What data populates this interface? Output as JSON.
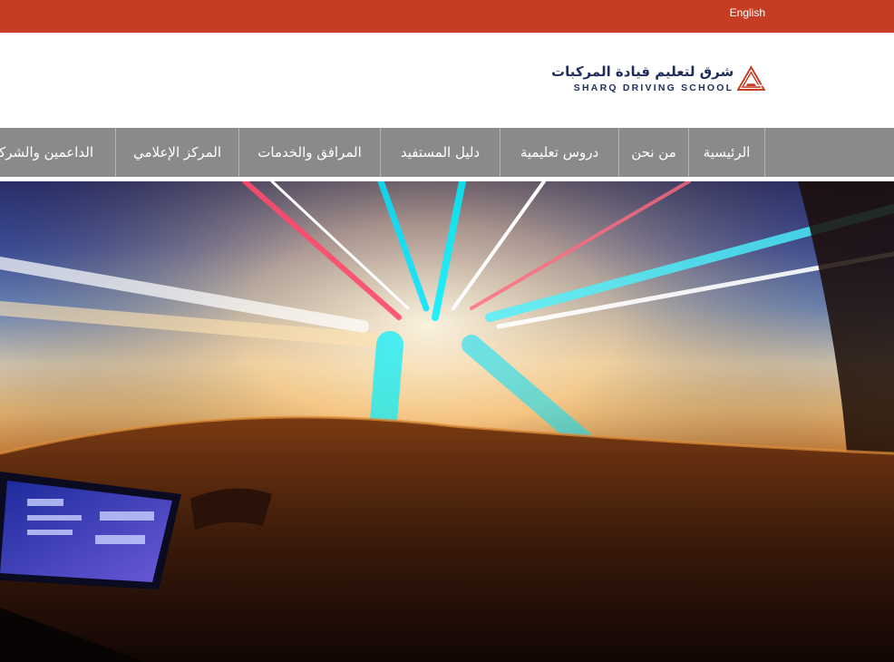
{
  "topbar": {
    "language_link": "English"
  },
  "logo": {
    "arabic_name": "شرق لتعليم قيادة المركبات",
    "english_name": "SHARQ DRIVING SCHOOL"
  },
  "nav": {
    "items": [
      {
        "label": "الرئيسية"
      },
      {
        "label": "من نحن"
      },
      {
        "label": "دروس تعليمية"
      },
      {
        "label": "دليل المستفيد"
      },
      {
        "label": "المرافق والخدمات"
      },
      {
        "label": "المركز الإعلامي"
      },
      {
        "label": "الداعمين والشركاء"
      }
    ]
  },
  "hero": {
    "image": "car-dashboard-light-trails"
  },
  "colors": {
    "brand_red": "#c63d23",
    "brand_navy": "#1e2d5c",
    "nav_gray": "#8a8a8a"
  }
}
